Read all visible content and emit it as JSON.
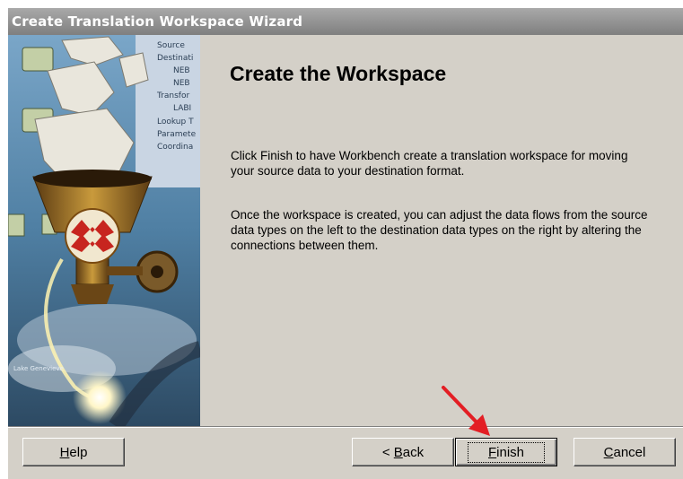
{
  "window": {
    "title": "Create Translation Workspace Wizard"
  },
  "banner": {
    "tree_labels": [
      "Source",
      "Destinati",
      "NEB",
      "NEB",
      "Transfor",
      "LABI",
      "Lookup T",
      "Paramete",
      "Coordina"
    ],
    "map_label": "Lake\nGenevieve"
  },
  "page": {
    "heading": "Create the Workspace",
    "paragraph1": "Click Finish to have Workbench create a translation workspace for moving your source data to your destination format.",
    "paragraph2": "Once the workspace is created, you can adjust the data flows from the source data types on the left to the destination data types on the right by altering the connections between them."
  },
  "buttons": {
    "help": {
      "mnemonic": "H",
      "rest": "elp"
    },
    "back": {
      "prefix": "< ",
      "mnemonic": "B",
      "rest": "ack"
    },
    "finish": {
      "mnemonic": "F",
      "rest": "inish"
    },
    "cancel": {
      "mnemonic": "C",
      "rest": "ancel"
    }
  },
  "annotation": {
    "arrow_color": "#e31e24"
  },
  "colors": {
    "dialog_bg": "#d4d0c8",
    "titlebar": "#8a8a8a"
  }
}
